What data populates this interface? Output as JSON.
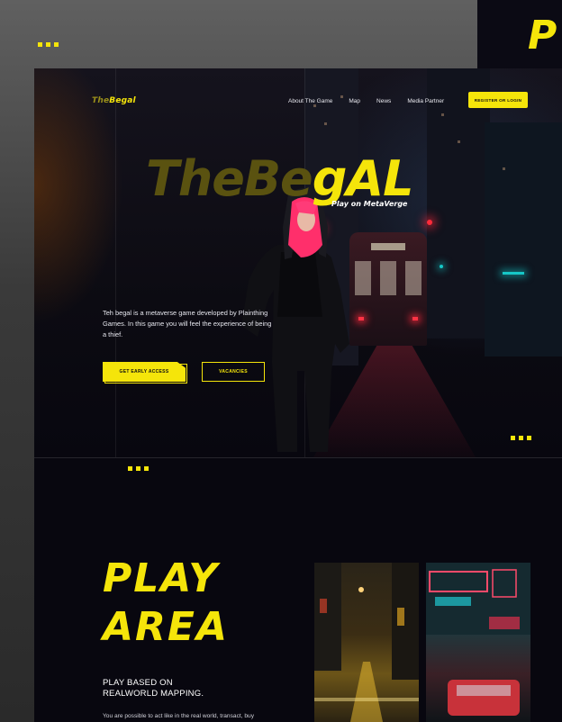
{
  "colors": {
    "accent": "#f5e50a",
    "background": "#08070f",
    "outer": "#4a4a4a"
  },
  "backdrop": {
    "partial_logo": "P"
  },
  "header": {
    "logo_part1": "The",
    "logo_part2": "Begal",
    "nav": [
      {
        "label": "About The Game"
      },
      {
        "label": "Map"
      },
      {
        "label": "News"
      },
      {
        "label": "Media Partner"
      }
    ],
    "cta_label": "REGISTER OR LOGIN"
  },
  "hero": {
    "title_part1": "TheBe",
    "title_part2": "gAL",
    "tagline": "Play on MetaVerge",
    "description": "Teh begal is a metaverse game developed by Plainthing Games. In this game you will feel the experience of being a thief.",
    "primary_button": "GET EARLY ACCESS",
    "secondary_button": "VACANCIES"
  },
  "play_area": {
    "title_line1": "PLAY",
    "title_line2": "AREA",
    "subtitle_line1": "PLAY BASED ON",
    "subtitle_line2": "REALWORLD MAPPING.",
    "body": "You are possible to act like in the real world, transact, buy"
  },
  "icons": {
    "deco": "square-dots"
  }
}
